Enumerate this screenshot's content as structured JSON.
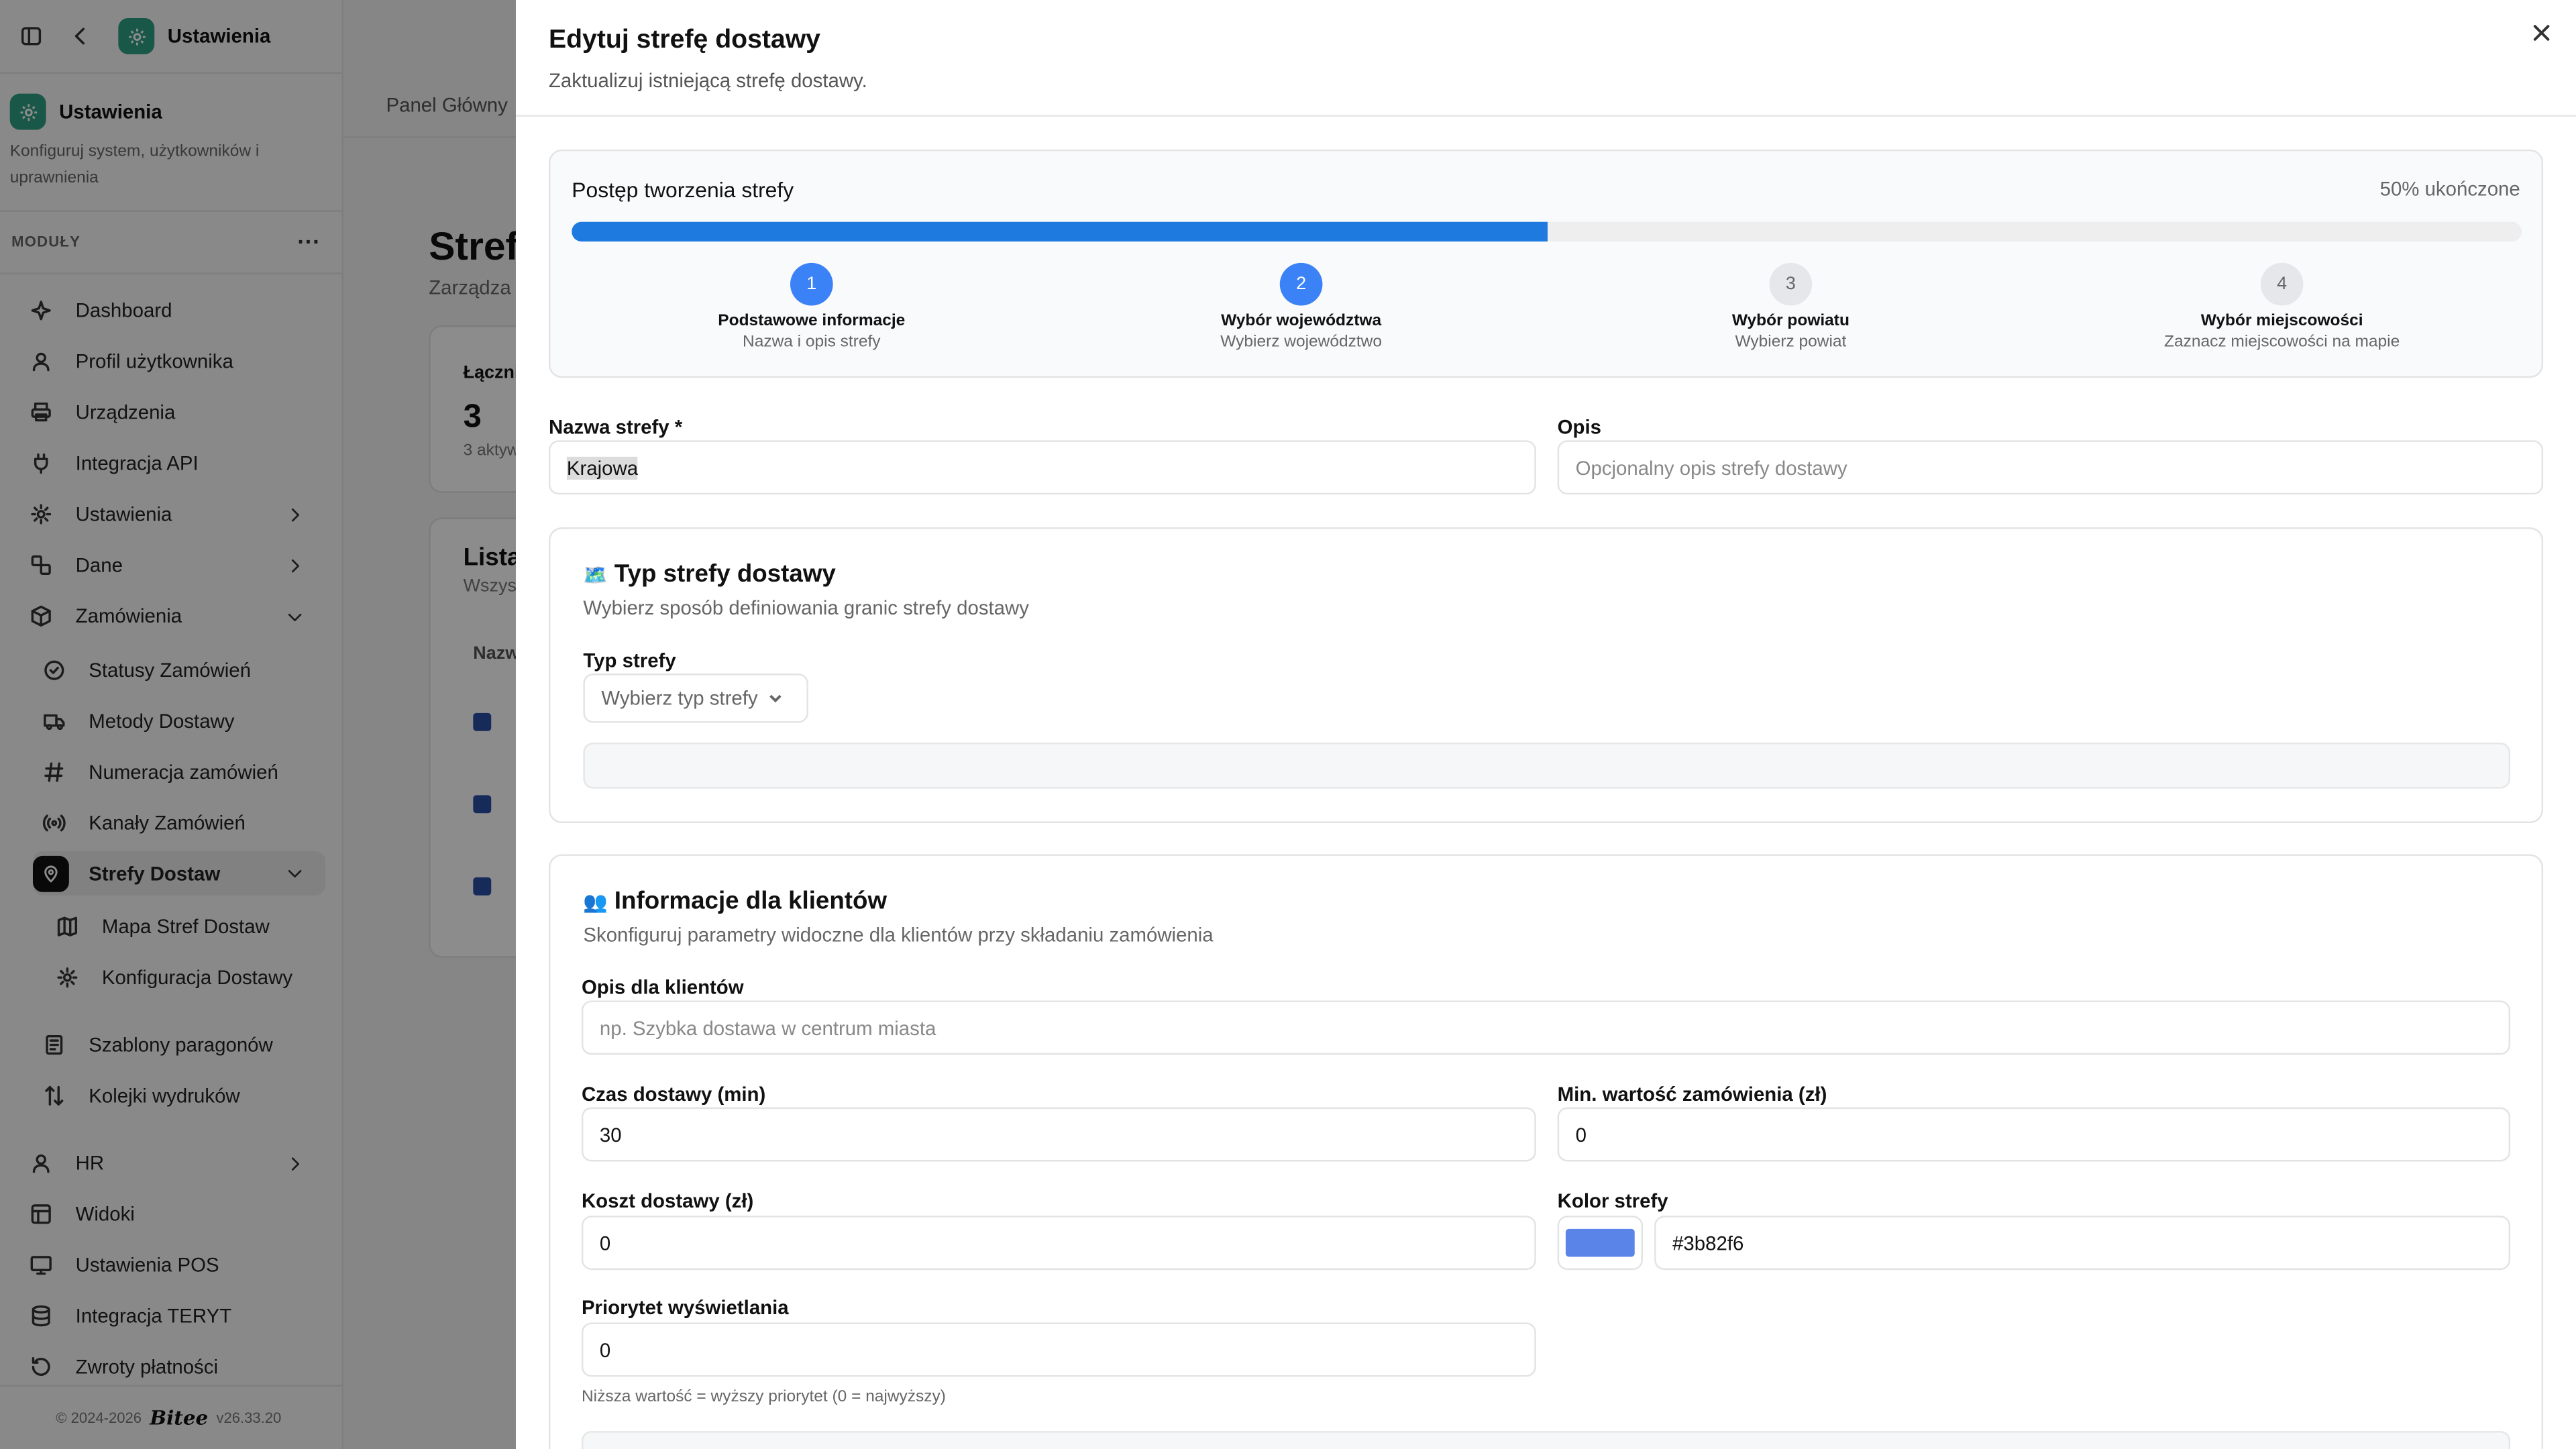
{
  "sidebar": {
    "app_title": "Ustawienia",
    "workspace_title": "Ustawienia",
    "workspace_desc": "Konfiguruj system, użytkowników i uprawnienia",
    "modules_label": "MODUŁY",
    "modules_more": "···",
    "items": [
      {
        "label": "Dashboard",
        "icon": "dashboard-icon"
      },
      {
        "label": "Profil użytkownika",
        "icon": "user-icon"
      },
      {
        "label": "Urządzenia",
        "icon": "printer-icon"
      },
      {
        "label": "Integracja API",
        "icon": "plug-icon"
      },
      {
        "label": "Ustawienia",
        "icon": "gear-icon"
      },
      {
        "label": "Dane",
        "icon": "data-icon"
      },
      {
        "label": "Zamówienia",
        "icon": "box-icon"
      },
      {
        "label": "Statusy Zamówień",
        "icon": "check-circle-icon"
      },
      {
        "label": "Metody Dostawy",
        "icon": "truck-icon"
      },
      {
        "label": "Numeracja zamówień",
        "icon": "hash-icon"
      },
      {
        "label": "Kanały Zamówień",
        "icon": "broadcast-icon"
      },
      {
        "label": "Strefy Dostaw",
        "icon": "map-pin-icon"
      },
      {
        "label": "Mapa Stref Dostaw",
        "icon": "map-icon"
      },
      {
        "label": "Konfiguracja Dostawy",
        "icon": "gear-icon"
      },
      {
        "label": "Szablony paragonów",
        "icon": "receipt-icon"
      },
      {
        "label": "Kolejki wydruków",
        "icon": "sort-icon"
      },
      {
        "label": "HR",
        "icon": "user-icon"
      },
      {
        "label": "Widoki",
        "icon": "layout-icon"
      },
      {
        "label": "Ustawienia POS",
        "icon": "monitor-icon"
      },
      {
        "label": "Integracja TERYT",
        "icon": "database-icon"
      },
      {
        "label": "Zwroty płatności",
        "icon": "refresh-icon"
      }
    ],
    "footer_copy": "© 2024-2026",
    "footer_brand": "Bitee",
    "footer_version": "v26.33.20"
  },
  "background": {
    "breadcrumb": "Panel Główny",
    "title": "Stref",
    "subtitle": "Zarządza",
    "stat_label": "Łączni",
    "stat_value": "3",
    "stat_sub": "3 aktyw",
    "list_title": "Lista",
    "list_sub": "Wszys",
    "col_name": "Nazw"
  },
  "sheet": {
    "title": "Edytuj strefę dostawy",
    "subtitle": "Zaktualizuj istniejącą strefę dostawy.",
    "progress": {
      "title": "Postęp tworzenia strefy",
      "percent_label": "50% ukończone",
      "percent": 0.5,
      "accent": "#1f7ae0",
      "steps": [
        {
          "num": "1",
          "title": "Podstawowe informacje",
          "desc": "Nazwa i opis strefy",
          "done": true
        },
        {
          "num": "2",
          "title": "Wybór województwa",
          "desc": "Wybierz województwo",
          "done": true
        },
        {
          "num": "3",
          "title": "Wybór powiatu",
          "desc": "Wybierz powiat",
          "done": false
        },
        {
          "num": "4",
          "title": "Wybór miejscowości",
          "desc": "Zaznacz miejscowości na mapie",
          "done": false
        }
      ]
    },
    "name_label": "Nazwa strefy *",
    "name_value": "Krajowa",
    "desc_label": "Opis",
    "desc_placeholder": "Opcjonalny opis strefy dostawy",
    "type_section": {
      "emoji": "🗺️",
      "title": "Typ strefy dostawy",
      "desc": "Wybierz sposób definiowania granic strefy dostawy",
      "field_label": "Typ strefy",
      "select_placeholder": "Wybierz typ strefy"
    },
    "client_section": {
      "emoji": "👥",
      "title": "Informacje dla klientów",
      "desc": "Skonfiguruj parametry widoczne dla klientów przy składaniu zamówienia",
      "client_desc_label": "Opis dla klientów",
      "client_desc_placeholder": "np. Szybka dostawa w centrum miasta",
      "time_label": "Czas dostawy (min)",
      "time_value": "30",
      "min_label": "Min. wartość zamówienia (zł)",
      "min_value": "0",
      "cost_label": "Koszt dostawy (zł)",
      "cost_value": "0",
      "color_label": "Kolor strefy",
      "color_value": "#3b82f6",
      "swatch_color": "#5b84e8",
      "priority_label": "Priorytet wyświetlania",
      "priority_value": "0",
      "priority_hint": "Niższa wartość = wyższy priorytet (0 = najwyższy)"
    }
  }
}
